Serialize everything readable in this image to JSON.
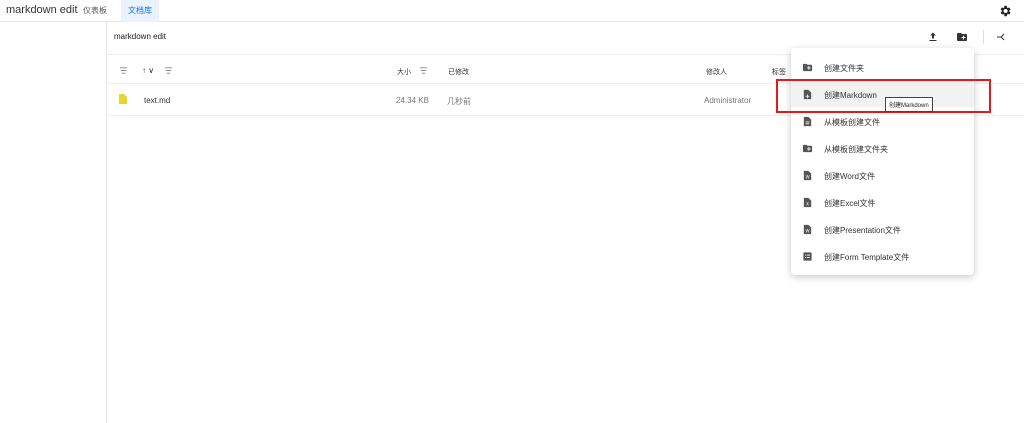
{
  "app": {
    "title": "markdown edit"
  },
  "nav": {
    "tabs": [
      {
        "label": "仪表板"
      },
      {
        "label": "文档库"
      }
    ]
  },
  "breadcrumb": "markdown edit",
  "columns": {
    "size": "大小",
    "created": "已修改",
    "modified_by": "修改人",
    "tags": "标签"
  },
  "files": [
    {
      "name": "text.md",
      "size": "24.34 KB",
      "time": "几秒前",
      "modified_by": "Administrator"
    }
  ],
  "menu": {
    "items": [
      {
        "label": "创建文件夹",
        "icon": "folder-icon"
      },
      {
        "label": "创建Markdown",
        "icon": "markdown-file-icon"
      },
      {
        "label": "从模板创建文件",
        "icon": "template-file-icon"
      },
      {
        "label": "从模板创建文件夹",
        "icon": "template-folder-icon"
      },
      {
        "label": "创建Word文件",
        "icon": "word-file-icon"
      },
      {
        "label": "创建Excel文件",
        "icon": "excel-file-icon"
      },
      {
        "label": "创建Presentation文件",
        "icon": "presentation-file-icon"
      },
      {
        "label": "创建Form Template文件",
        "icon": "form-template-icon"
      }
    ]
  },
  "tooltip": "创建Markdown",
  "colors": {
    "accent": "#1a73e8",
    "highlight": "#e8161d",
    "file_icon": "#e6d52a",
    "icon_gray": "#555555"
  }
}
